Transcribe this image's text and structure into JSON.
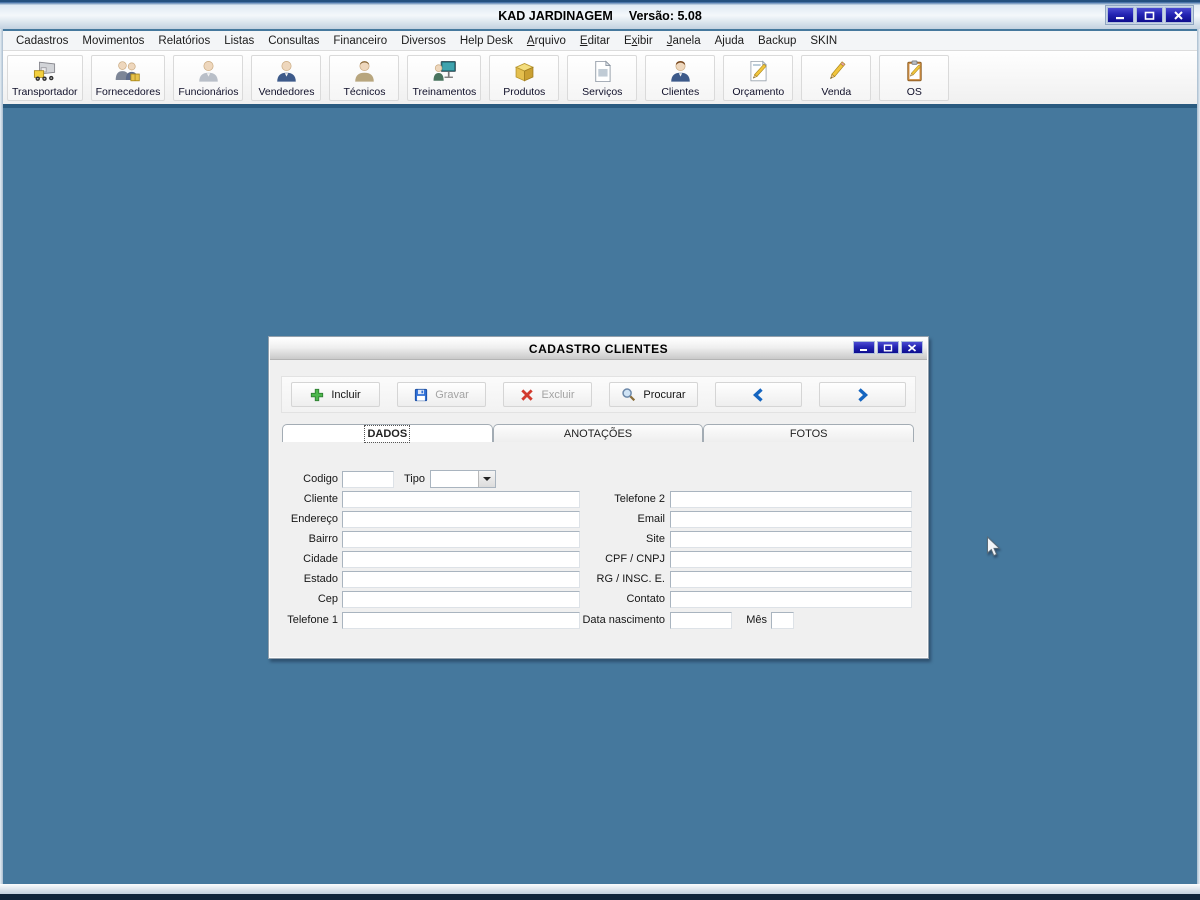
{
  "window": {
    "title": "KAD JARDINAGEM",
    "version": "Versão: 5.08"
  },
  "menu": {
    "items": [
      {
        "label": "Cadastros",
        "u": -1
      },
      {
        "label": "Movimentos",
        "u": -1
      },
      {
        "label": "Relatórios",
        "u": -1
      },
      {
        "label": "Listas",
        "u": -1
      },
      {
        "label": "Consultas",
        "u": -1
      },
      {
        "label": "Financeiro",
        "u": -1
      },
      {
        "label": "Diversos",
        "u": -1
      },
      {
        "label": "Help Desk",
        "u": -1
      },
      {
        "label": "Arquivo",
        "u": 0
      },
      {
        "label": "Editar",
        "u": 0
      },
      {
        "label": "Exibir",
        "u": 1
      },
      {
        "label": "Janela",
        "u": 0
      },
      {
        "label": "Ajuda",
        "u": -1
      },
      {
        "label": "Backup",
        "u": -1
      },
      {
        "label": "SKIN",
        "u": -1
      }
    ]
  },
  "toolbar": {
    "buttons": [
      {
        "label": "Transportador",
        "icon": "truck-icon"
      },
      {
        "label": "Fornecedores",
        "icon": "suppliers-icon"
      },
      {
        "label": "Funcionários",
        "icon": "employee-icon"
      },
      {
        "label": "Vendedores",
        "icon": "salesperson-icon"
      },
      {
        "label": "Técnicos",
        "icon": "technician-icon"
      },
      {
        "label": "Treinamentos",
        "icon": "training-icon"
      },
      {
        "label": "Produtos",
        "icon": "box-icon"
      },
      {
        "label": "Serviços",
        "icon": "document-icon"
      },
      {
        "label": "Clientes",
        "icon": "client-icon"
      },
      {
        "label": "Orçamento",
        "icon": "quote-icon"
      },
      {
        "label": "Venda",
        "icon": "pencil-icon"
      },
      {
        "label": "OS",
        "icon": "clipboard-icon"
      }
    ]
  },
  "dialog": {
    "title": "CADASTRO CLIENTES",
    "actions": [
      {
        "label": "Incluir",
        "icon": "add-icon",
        "enabled": true
      },
      {
        "label": "Gravar",
        "icon": "save-icon",
        "enabled": false
      },
      {
        "label": "Excluir",
        "icon": "delete-icon",
        "enabled": false
      },
      {
        "label": "Procurar",
        "icon": "search-icon",
        "enabled": true
      },
      {
        "label": "",
        "icon": "prev-icon",
        "enabled": true
      },
      {
        "label": "",
        "icon": "next-icon",
        "enabled": true
      }
    ],
    "tabs": [
      {
        "label": "DADOS",
        "active": true
      },
      {
        "label": "ANOTAÇÕES",
        "active": false
      },
      {
        "label": "FOTOS",
        "active": false
      }
    ],
    "form": {
      "fields_left": [
        "Codigo",
        "Cliente",
        "Endereço",
        "Bairro",
        "Cidade",
        "Estado",
        "Cep",
        "Telefone 1"
      ],
      "fields_right": [
        "Telefone 2",
        "Email",
        "Site",
        "CPF / CNPJ",
        "RG / INSC. E.",
        "Contato",
        "Data nascimento"
      ],
      "tipo_label": "Tipo",
      "mes_label": "Mês",
      "empty_value": ""
    }
  },
  "colors": {
    "desktop": "#45789D",
    "titlebar_button": "#1414A0",
    "toolbar_divider": "#2A5B80"
  }
}
